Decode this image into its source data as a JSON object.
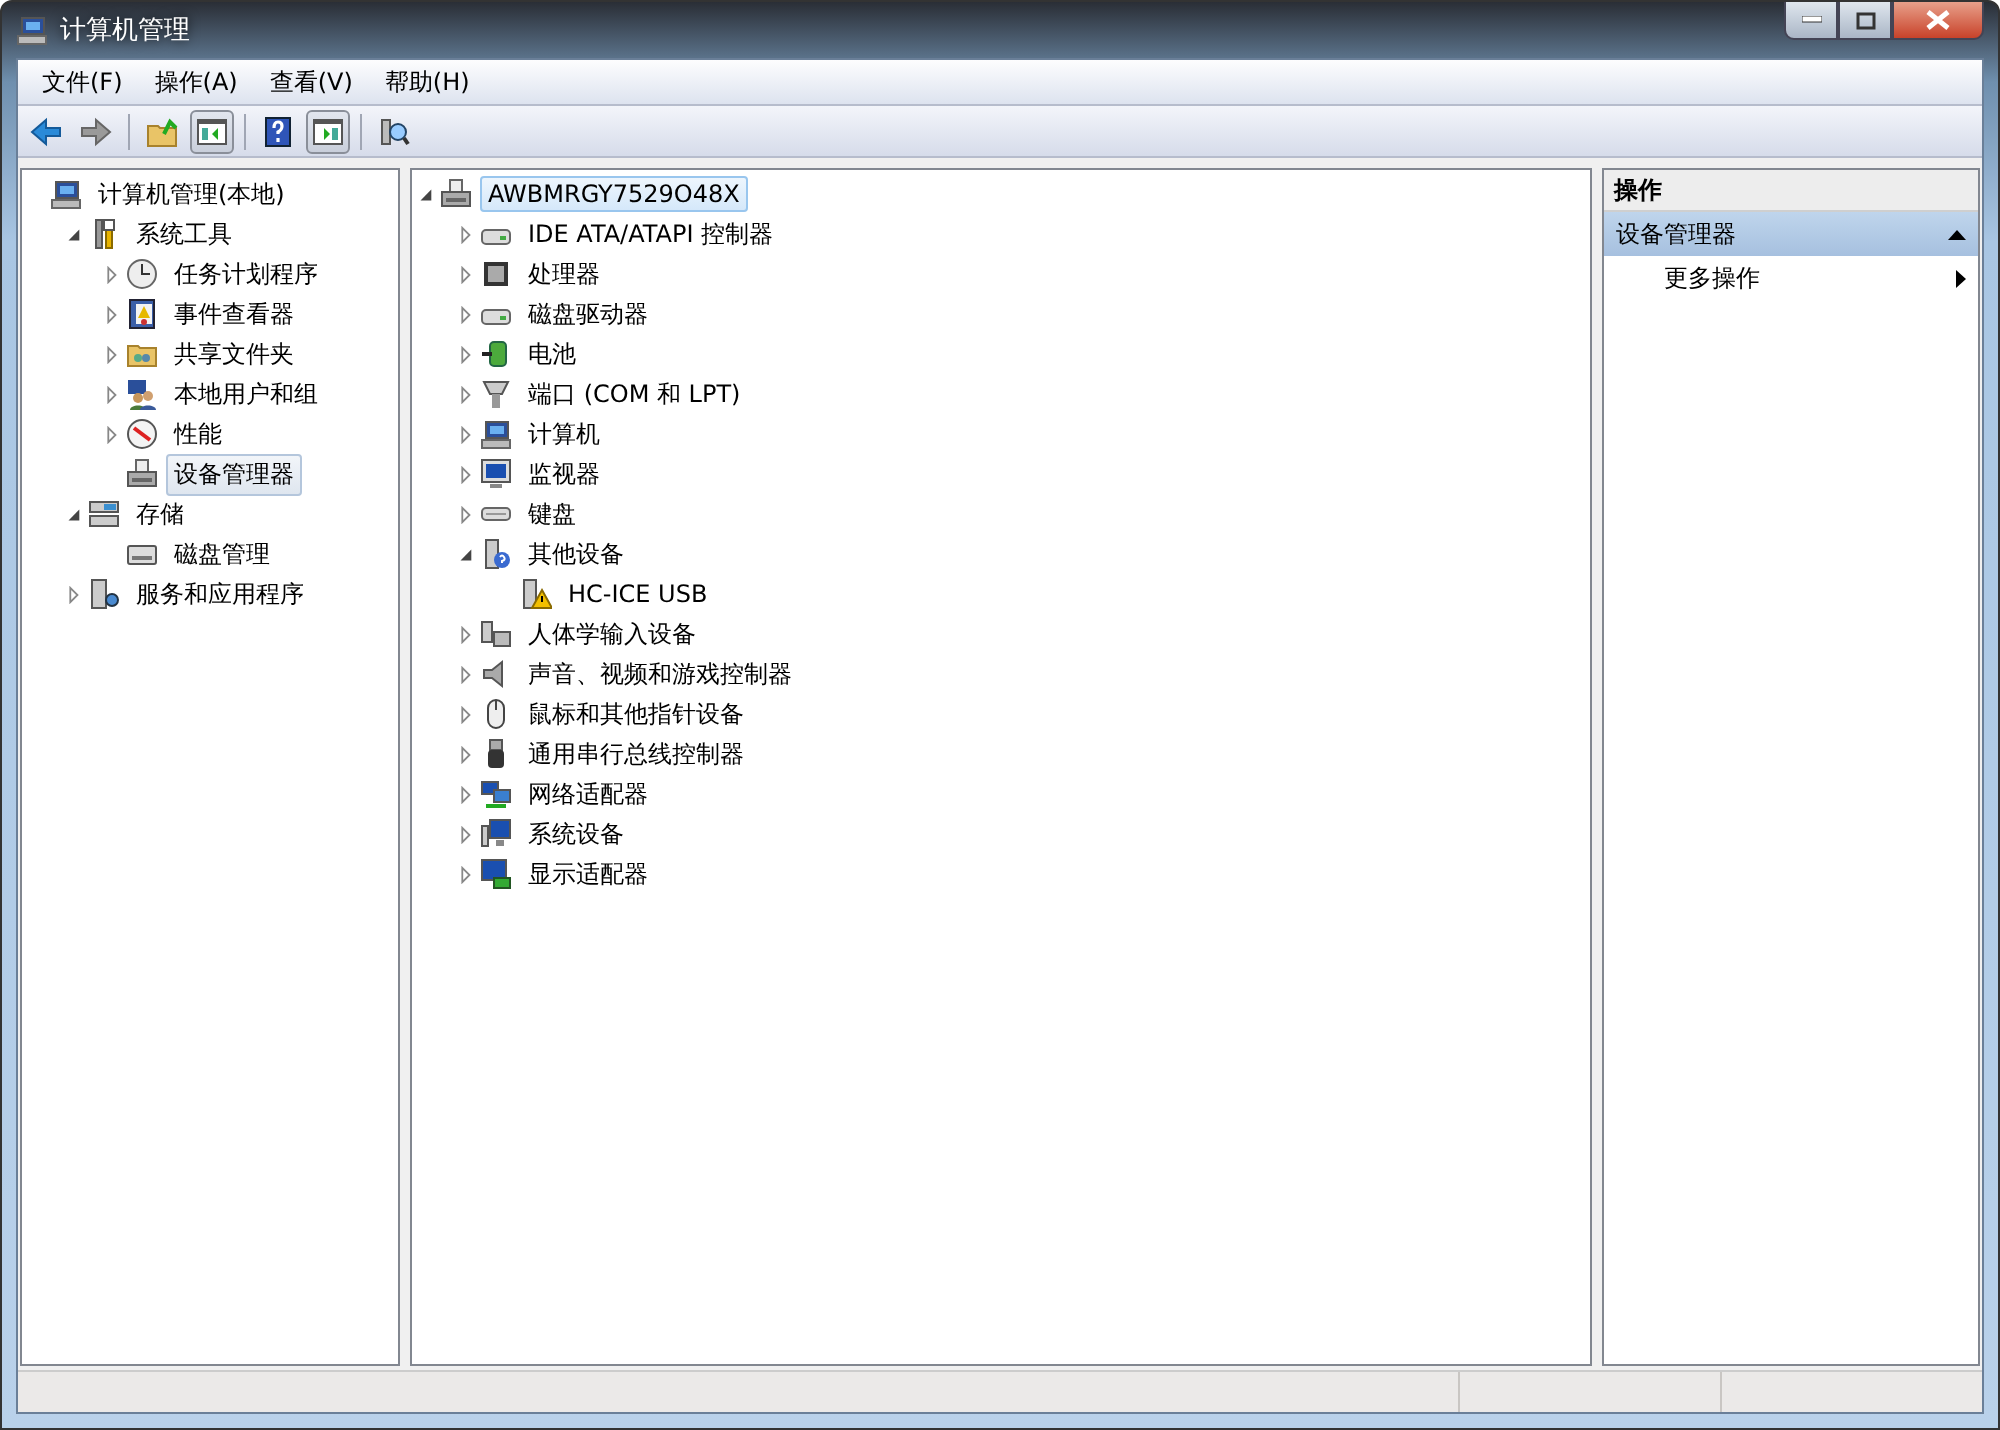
{
  "window": {
    "title": "计算机管理"
  },
  "menu": [
    {
      "label": "文件(F)"
    },
    {
      "label": "操作(A)"
    },
    {
      "label": "查看(V)"
    },
    {
      "label": "帮助(H)"
    }
  ],
  "toolbar": [
    {
      "kind": "back",
      "disabled": false
    },
    {
      "kind": "forward",
      "disabled": true
    },
    {
      "kind": "sep"
    },
    {
      "kind": "up"
    },
    {
      "kind": "tree-toggle",
      "on": true
    },
    {
      "kind": "sep"
    },
    {
      "kind": "help"
    },
    {
      "kind": "pane-toggle",
      "on": true
    },
    {
      "kind": "sep"
    },
    {
      "kind": "scan"
    }
  ],
  "console_tree": [
    {
      "label": "计算机管理(本地)",
      "expandable": false,
      "selected": false,
      "children": [
        {
          "label": "系统工具",
          "expandable": true,
          "expanded": true,
          "selected": false,
          "children": [
            {
              "label": "任务计划程序",
              "expandable": true,
              "expanded": false,
              "selected": false
            },
            {
              "label": "事件查看器",
              "expandable": true,
              "expanded": false,
              "selected": false
            },
            {
              "label": "共享文件夹",
              "expandable": true,
              "expanded": false,
              "selected": false
            },
            {
              "label": "本地用户和组",
              "expandable": true,
              "expanded": false,
              "selected": false
            },
            {
              "label": "性能",
              "expandable": true,
              "expanded": false,
              "selected": false
            },
            {
              "label": "设备管理器",
              "expandable": false,
              "selected": true
            }
          ]
        },
        {
          "label": "存储",
          "expandable": true,
          "expanded": true,
          "selected": false,
          "children": [
            {
              "label": "磁盘管理",
              "expandable": false,
              "selected": false
            }
          ]
        },
        {
          "label": "服务和应用程序",
          "expandable": true,
          "expanded": false,
          "selected": false
        }
      ]
    }
  ],
  "device_tree": [
    {
      "label": "AWBMRGY7529O48X",
      "expandable": true,
      "expanded": true,
      "selected": true,
      "children": [
        {
          "label": "IDE ATA/ATAPI 控制器",
          "expandable": true,
          "expanded": false,
          "selected": false
        },
        {
          "label": "处理器",
          "expandable": true,
          "expanded": false,
          "selected": false
        },
        {
          "label": "磁盘驱动器",
          "expandable": true,
          "expanded": false,
          "selected": false
        },
        {
          "label": "电池",
          "expandable": true,
          "expanded": false,
          "selected": false
        },
        {
          "label": "端口 (COM 和 LPT)",
          "expandable": true,
          "expanded": false,
          "selected": false
        },
        {
          "label": "计算机",
          "expandable": true,
          "expanded": false,
          "selected": false
        },
        {
          "label": "监视器",
          "expandable": true,
          "expanded": false,
          "selected": false
        },
        {
          "label": "键盘",
          "expandable": true,
          "expanded": false,
          "selected": false
        },
        {
          "label": "其他设备",
          "expandable": true,
          "expanded": true,
          "selected": false,
          "children": [
            {
              "label": "HC-ICE USB",
              "expandable": false,
              "selected": false
            }
          ]
        },
        {
          "label": "人体学输入设备",
          "expandable": true,
          "expanded": false,
          "selected": false
        },
        {
          "label": "声音、视频和游戏控制器",
          "expandable": true,
          "expanded": false,
          "selected": false
        },
        {
          "label": "鼠标和其他指针设备",
          "expandable": true,
          "expanded": false,
          "selected": false
        },
        {
          "label": "通用串行总线控制器",
          "expandable": true,
          "expanded": false,
          "selected": false
        },
        {
          "label": "网络适配器",
          "expandable": true,
          "expanded": false,
          "selected": false
        },
        {
          "label": "系统设备",
          "expandable": true,
          "expanded": false,
          "selected": false
        },
        {
          "label": "显示适配器",
          "expandable": true,
          "expanded": false,
          "selected": false
        }
      ]
    }
  ],
  "actions": {
    "header": "操作",
    "sections": [
      {
        "title": "设备管理器",
        "expanded": true,
        "items": [
          {
            "label": "更多操作"
          }
        ]
      }
    ]
  }
}
